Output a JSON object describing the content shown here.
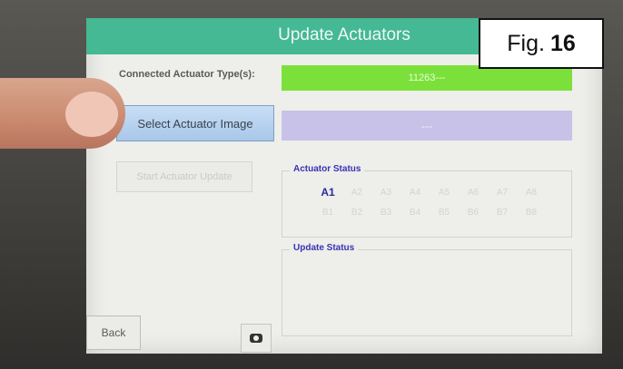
{
  "window": {
    "title": "Update Actuators"
  },
  "connected": {
    "label": "Connected Actuator Type(s):",
    "value": "11263---"
  },
  "select_button": {
    "label": "Select Actuator Image"
  },
  "image_value": "---",
  "start_button": {
    "label": "Start Actuator Update"
  },
  "actuator_status": {
    "title": "Actuator Status",
    "cells": [
      "A1",
      "A2",
      "A3",
      "A4",
      "A5",
      "A6",
      "A7",
      "A8",
      "B1",
      "B2",
      "B3",
      "B4",
      "B5",
      "B6",
      "B7",
      "B8"
    ],
    "active": "A1"
  },
  "update_status": {
    "title": "Update Status"
  },
  "back_button": {
    "label": "Back"
  },
  "camera_icon": "camera-icon",
  "figure_label": {
    "prefix": "Fig.",
    "number": "16"
  },
  "colors": {
    "titlebar": "#45b894",
    "green_bar": "#7be13a",
    "lilac_bar": "#c8c2e8",
    "select_button": "#b8d4f0",
    "group_title": "#3a31b5"
  }
}
